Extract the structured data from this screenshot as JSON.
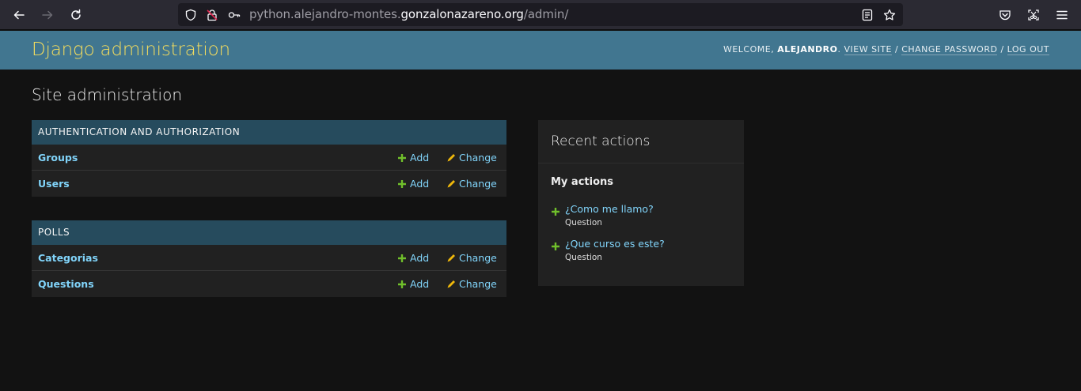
{
  "browser": {
    "url_prefix": "python.alejandro-montes.",
    "url_domain": "gonzalonazareno.org",
    "url_path": "/admin/",
    "icons": [
      "back-icon",
      "forward-icon",
      "reload-icon",
      "shield-icon",
      "lock-broken-icon",
      "key-icon",
      "reader-view-icon",
      "bookmark-star-icon",
      "pocket-icon",
      "screenshot-icon",
      "menu-icon"
    ]
  },
  "header": {
    "branding": "Django administration",
    "welcome": "WELCOME, ",
    "username": "ALEJANDRO",
    "dot": ". ",
    "view_site": "VIEW SITE",
    "sep1": " / ",
    "change_password": "CHANGE PASSWORD",
    "sep2": " / ",
    "logout": "LOG OUT"
  },
  "page_title": "Site administration",
  "apps": [
    {
      "caption": "AUTHENTICATION AND AUTHORIZATION",
      "models": [
        {
          "name": "Groups",
          "add": "Add",
          "change": "Change"
        },
        {
          "name": "Users",
          "add": "Add",
          "change": "Change"
        }
      ]
    },
    {
      "caption": "POLLS",
      "models": [
        {
          "name": "Categorias",
          "add": "Add",
          "change": "Change"
        },
        {
          "name": "Questions",
          "add": "Add",
          "change": "Change"
        }
      ]
    }
  ],
  "recent": {
    "title": "Recent actions",
    "my_actions": "My actions",
    "items": [
      {
        "title": "¿Como me llamo?",
        "type": "Question"
      },
      {
        "title": "¿Que curso es este?",
        "type": "Question"
      }
    ]
  },
  "colors": {
    "header_bg": "#417690",
    "branding": "#f5dd5d",
    "caption_bg": "#264b5d",
    "link": "#81d4fa",
    "add_green": "#70bf2b",
    "change_yellow": "#efb80b"
  }
}
